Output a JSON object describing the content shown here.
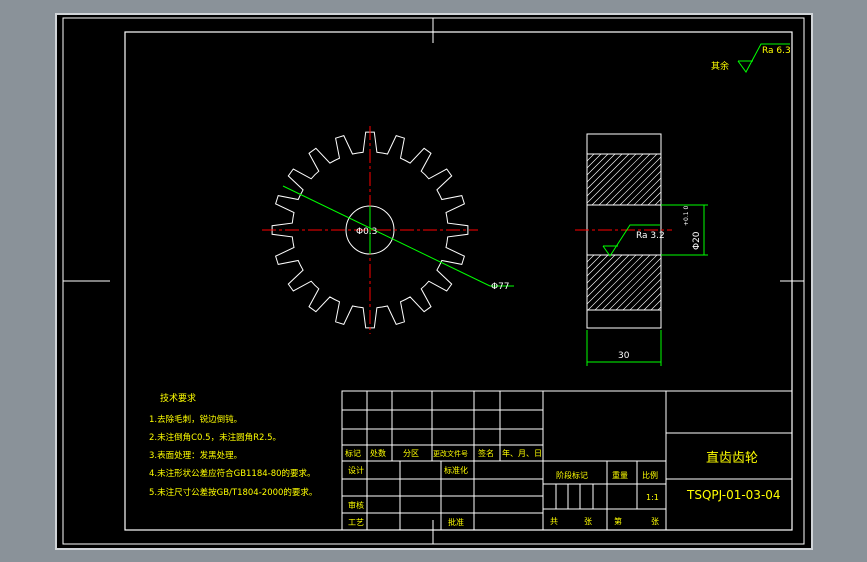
{
  "roughness_note": {
    "label": "其余",
    "value": "Ra 6.3"
  },
  "gear_front": {
    "bore_label": "Φ0.3",
    "od_label": "Φ77",
    "teeth": 20
  },
  "side_view": {
    "bore_dim": "Φ20",
    "bore_tol": "+0.1 0",
    "roughness": "Ra 3.2",
    "width_dim": "30"
  },
  "tech_requirements": {
    "title": "技术要求",
    "items": [
      "1.去除毛刺，锐边倒钝。",
      "2.未注倒角C0.5，未注圆角R2.5。",
      "3.表面处理：发黑处理。",
      "4.未注形状公差应符合GB1184-80的要求。",
      "5.未注尺寸公差按GB/T1804-2000的要求。"
    ]
  },
  "title_block": {
    "part_name": "直齿齿轮",
    "drawing_no": "TSQPJ-01-03-04",
    "scale": "1:1",
    "headers": [
      "标记",
      "处数",
      "分区",
      "更改文件号",
      "签名",
      "年、月、日"
    ],
    "design": "设计",
    "standardize": "标准化",
    "review": "审核",
    "process": "工艺",
    "approve": "批准",
    "stage_mark": "阶段标记",
    "weight": "重量",
    "ratio": "比例",
    "total": "共",
    "sheets": "张",
    "page": "第",
    "sheet2": "张"
  }
}
